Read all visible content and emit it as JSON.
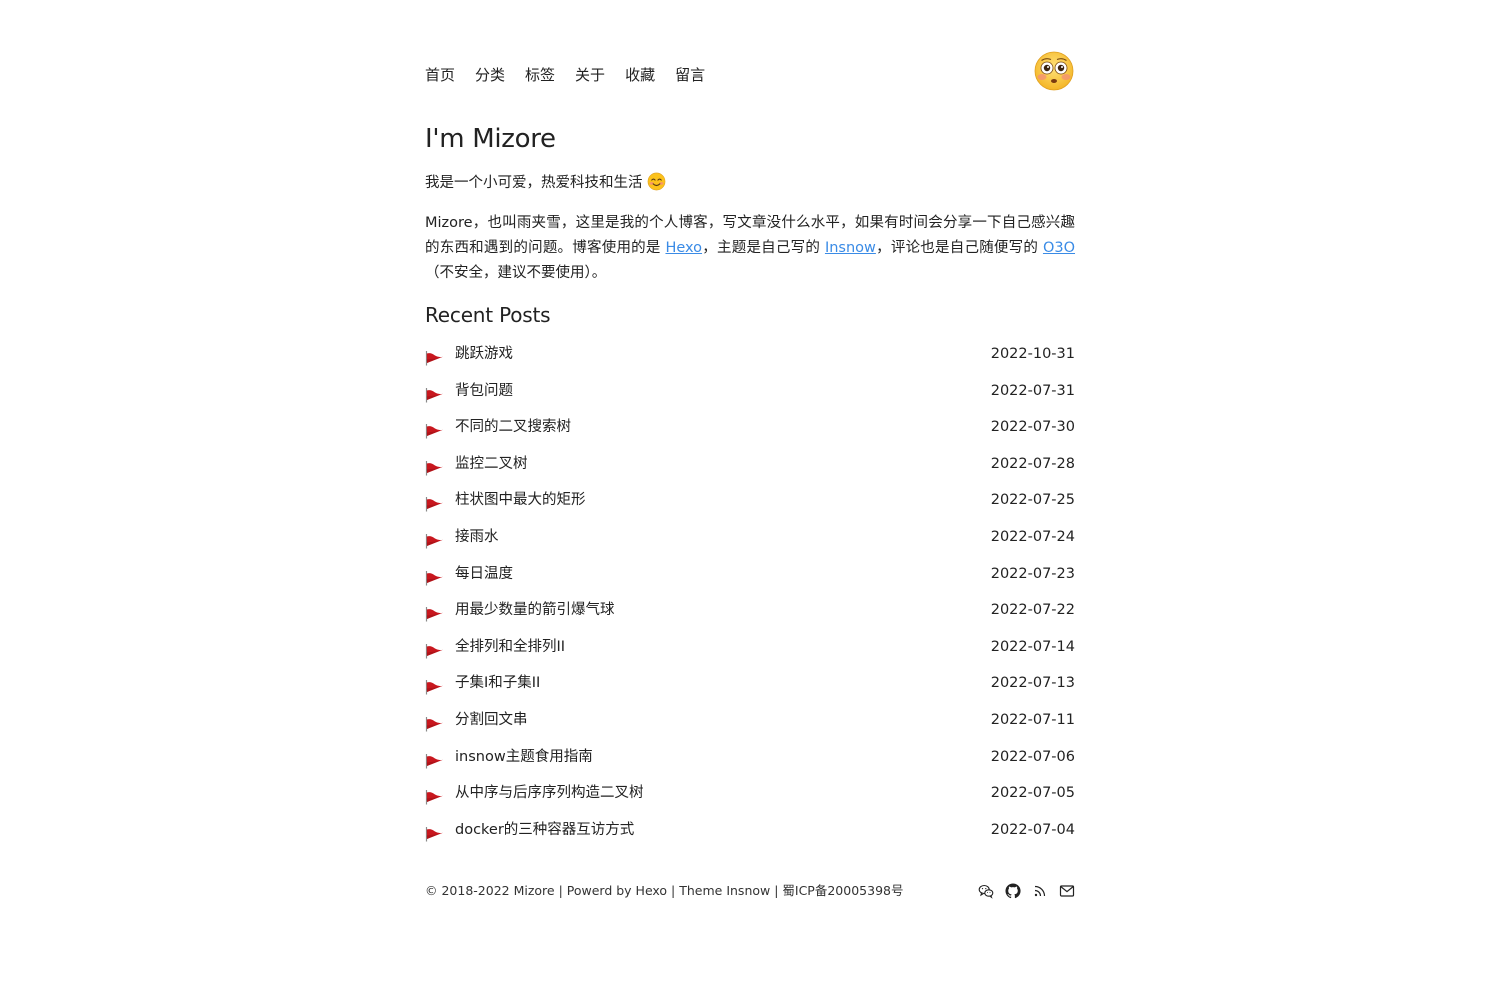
{
  "nav": {
    "items": [
      {
        "label": "首页"
      },
      {
        "label": "分类"
      },
      {
        "label": "标签"
      },
      {
        "label": "关于"
      },
      {
        "label": "收藏"
      },
      {
        "label": "留言"
      }
    ]
  },
  "intro": {
    "title": "I'm Mizore",
    "tagline": "我是一个小可爱，热爱科技和生活",
    "about_part1": "Mizore，也叫雨夹雪，这里是我的个人博客，写文章没什么水平，如果有时间会分享一下自己感兴趣的东西和遇到的问题。博客使用的是 ",
    "hexo_link": "Hexo",
    "about_part2": "，主题是自己写的 ",
    "insnow_link": "Insnow",
    "about_part3": "，评论也是自己随便写的 ",
    "o3o_link": "O3O",
    "about_part4": "（不安全，建议不要使用）。"
  },
  "recent": {
    "heading": "Recent Posts",
    "posts": [
      {
        "title": "跳跃游戏",
        "date": "2022-10-31"
      },
      {
        "title": "背包问题",
        "date": "2022-07-31"
      },
      {
        "title": "不同的二叉搜索树",
        "date": "2022-07-30"
      },
      {
        "title": "监控二叉树",
        "date": "2022-07-28"
      },
      {
        "title": "柱状图中最大的矩形",
        "date": "2022-07-25"
      },
      {
        "title": "接雨水",
        "date": "2022-07-24"
      },
      {
        "title": "每日温度",
        "date": "2022-07-23"
      },
      {
        "title": "用最少数量的箭引爆气球",
        "date": "2022-07-22"
      },
      {
        "title": "全排列和全排列II",
        "date": "2022-07-14"
      },
      {
        "title": "子集I和子集II",
        "date": "2022-07-13"
      },
      {
        "title": "分割回文串",
        "date": "2022-07-11"
      },
      {
        "title": "insnow主题食用指南",
        "date": "2022-07-06"
      },
      {
        "title": "从中序与后序序列构造二叉树",
        "date": "2022-07-05"
      },
      {
        "title": "docker的三种容器互访方式",
        "date": "2022-07-04"
      }
    ]
  },
  "footer": {
    "text": "© 2018-2022 Mizore | Powerd by Hexo | Theme Insnow | 蜀ICP备20005398号",
    "icons": [
      "wechat-icon",
      "github-icon",
      "rss-icon",
      "mail-icon"
    ]
  },
  "colors": {
    "link": "#3a8be6",
    "flag": "#c8171e",
    "text": "#222222"
  }
}
